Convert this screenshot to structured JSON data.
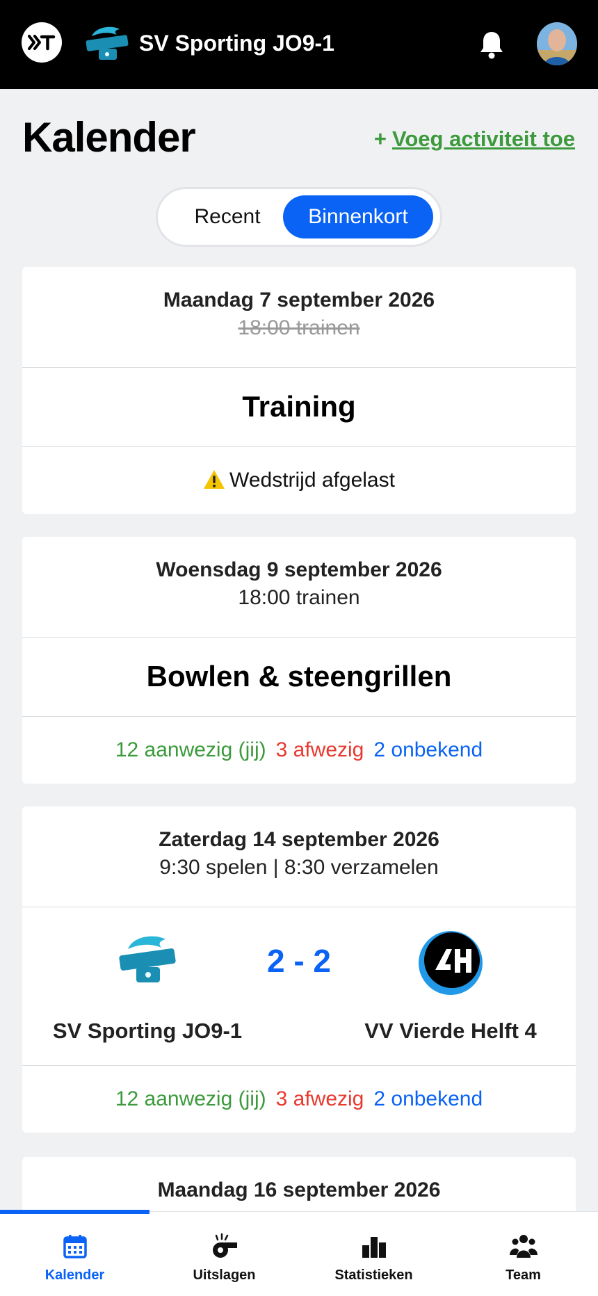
{
  "header": {
    "title": "SV Sporting JO9-1",
    "app_logo_icon": "app-logo-icon",
    "club_logo_icon": "club-crest-icon",
    "notification_icon": "bell-icon",
    "avatar_icon": "user-avatar"
  },
  "page": {
    "title": "Kalender",
    "add_plus": "+",
    "add_label": "Voeg activiteit toe"
  },
  "tabs": {
    "recent": "Recent",
    "upcoming": "Binnenkort",
    "selected": "Binnenkort"
  },
  "events": [
    {
      "date": "Maandag 7 september 2026",
      "time": "18:00 trainen",
      "title": "Training",
      "status": "Wedstrijd afgelast"
    },
    {
      "date": "Woensdag 9 september 2026",
      "time": "18:00 trainen",
      "title": "Bowlen & steengrillen",
      "attendance": {
        "present": "12 aanwezig (jij)",
        "absent": "3 afwezig",
        "unknown": "2 onbekend"
      }
    },
    {
      "date": "Zaterdag 14 september 2026",
      "time": "9:30 spelen | 8:30 verzamelen",
      "home": "SV Sporting JO9-1",
      "away": "VV Vierde Helft 4",
      "score": "2 - 2",
      "attendance": {
        "present": "12 aanwezig (jij)",
        "absent": "3 afwezig",
        "unknown": "2 onbekend"
      }
    },
    {
      "date": "Maandag 16 september 2026"
    }
  ],
  "nav": {
    "items": [
      {
        "label": "Kalender",
        "icon": "calendar-icon"
      },
      {
        "label": "Uitslagen",
        "icon": "whistle-icon"
      },
      {
        "label": "Statistieken",
        "icon": "bar-chart-icon"
      },
      {
        "label": "Team",
        "icon": "team-icon"
      }
    ],
    "active": "Kalender"
  },
  "colors": {
    "accent": "#0a63f5",
    "present": "#3c9a3c",
    "absent": "#e8392f",
    "header": "#000000"
  }
}
